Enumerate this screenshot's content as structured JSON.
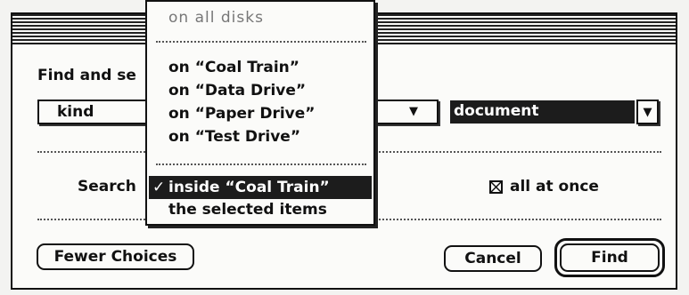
{
  "dialog": {
    "find_label": "Find and se",
    "criteria_field": "kind",
    "criteria_value": "document",
    "search_label": "Search",
    "all_at_once_label": "all at once",
    "all_at_once_checked": true,
    "fewer_choices_label": "Fewer Choices",
    "cancel_label": "Cancel",
    "find_label_button": "Find"
  },
  "popup": {
    "items": [
      {
        "label": "on all disks",
        "enabled": false
      },
      {
        "label": "on “Coal Train”",
        "enabled": true
      },
      {
        "label": "on “Data Drive”",
        "enabled": true
      },
      {
        "label": "on “Paper Drive”",
        "enabled": true
      },
      {
        "label": "on “Test Drive”",
        "enabled": true
      },
      {
        "label": "inside “Coal Train”",
        "enabled": true,
        "selected": true,
        "checkmark": "✓"
      },
      {
        "label": "the selected items",
        "enabled": true
      }
    ]
  },
  "icons": {
    "dropdown": "down-triangle",
    "checkbox": "x-mark"
  }
}
